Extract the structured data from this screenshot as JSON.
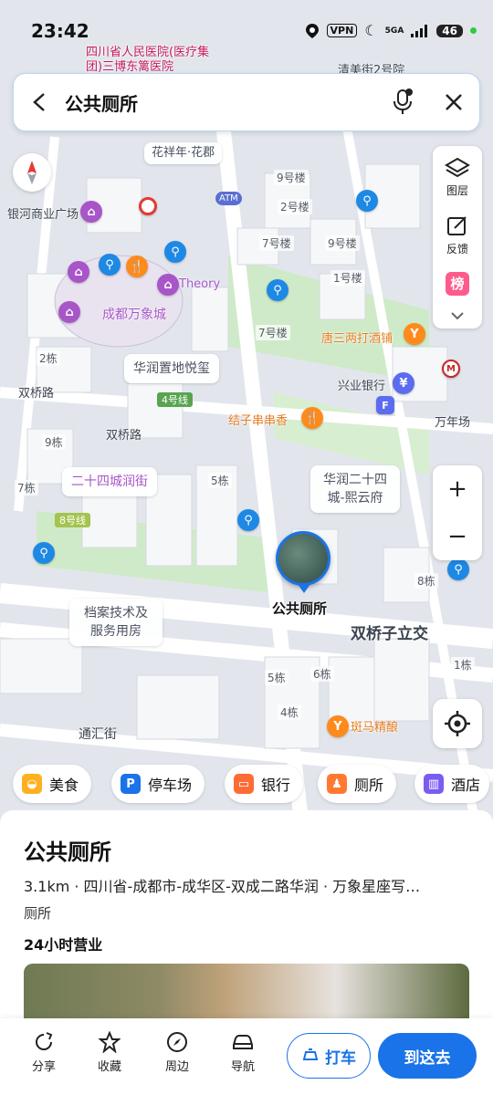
{
  "status_bar": {
    "time": "23:42",
    "vpn": "VPN",
    "network": "5GA",
    "battery": "46"
  },
  "search": {
    "query": "公共厕所"
  },
  "side_panel": {
    "layers": "图层",
    "feedback": "反馈",
    "rank": "榜"
  },
  "map_labels": {
    "hospital": "四川省人民医院(医疗集团)三博东篱医院",
    "jingmei": "清美街2号院",
    "huayang": "花祥年·花郡",
    "yinhe": "银河商业广场",
    "theory": "Theory",
    "mixc": "成都万象城",
    "yuexi": "华润置地悦玺",
    "tangsan": "唐三两打酒铺",
    "xingye": "兴业银行",
    "wancheng": "万年场",
    "shuangqiao1": "双桥路",
    "shuangqiao2": "双桥路",
    "jiezi": "结子串串香",
    "runjie": "二十四城润街",
    "xiyun": "华润二十四城-熙云府",
    "archive": "档案技术及服务用房",
    "interchange": "双桥子立交",
    "banma": "斑马精酿",
    "tongji": "通汇街",
    "selected": "公共厕所",
    "line4": "4号线",
    "line8": "8号线",
    "atm": "ATM",
    "b_9": "9号楼",
    "b_2": "2号楼",
    "b_7a": "7号楼",
    "b_9b": "9号楼",
    "b_1": "1号楼",
    "b_7b": "7号楼",
    "b_2d": "2栋",
    "b_9d": "9栋",
    "b_7d": "7栋",
    "b_5d": "5栋",
    "b_8d": "8栋",
    "b_5d2": "5栋",
    "b_6d": "6栋",
    "b_4d": "4栋",
    "b_1d": "1栋"
  },
  "chips": [
    {
      "label": "美食",
      "icon": "food-icon",
      "color": "#ffb020"
    },
    {
      "label": "停车场",
      "icon": "parking-icon",
      "color": "#1a73e8"
    },
    {
      "label": "银行",
      "icon": "bank-icon",
      "color": "#ff6b35"
    },
    {
      "label": "厕所",
      "icon": "toilet-icon",
      "color": "#ff7a30"
    },
    {
      "label": "酒店",
      "icon": "hotel-icon",
      "color": "#7b5cf0"
    }
  ],
  "place": {
    "title": "公共厕所",
    "address": "3.1km · 四川省-成都市-成华区-双成二路华润 · 万象星座写…",
    "category": "厕所",
    "hours": "24小时营业"
  },
  "actions": {
    "share": "分享",
    "favorite": "收藏",
    "nearby": "周边",
    "navigate": "导航",
    "taxi": "打车",
    "go": "到这去"
  },
  "colors": {
    "accent": "#1a73e8",
    "wc": "#1e88e5"
  }
}
